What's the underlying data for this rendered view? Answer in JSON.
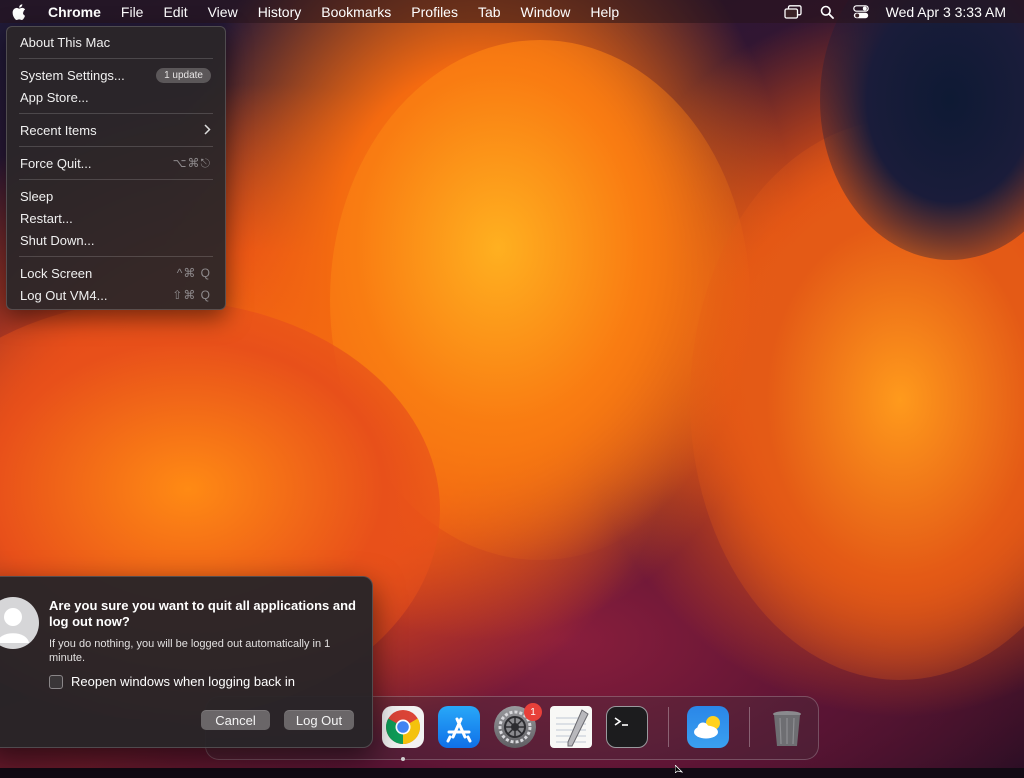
{
  "menubar": {
    "app_name": "Chrome",
    "items": [
      "File",
      "Edit",
      "View",
      "History",
      "Bookmarks",
      "Profiles",
      "Tab",
      "Window",
      "Help"
    ],
    "clock": "Wed Apr 3  3:33 AM",
    "icons": [
      "apple-icon",
      "window-stack-icon",
      "search-icon",
      "control-center-icon"
    ]
  },
  "apple_menu": {
    "about": "About This Mac",
    "system_settings": "System Settings...",
    "update_badge": "1 update",
    "app_store": "App Store...",
    "recent_items": "Recent Items",
    "force_quit": "Force Quit...",
    "force_quit_shortcut": "⌥⌘⎋",
    "sleep": "Sleep",
    "restart": "Restart...",
    "shut_down": "Shut Down...",
    "lock_screen": "Lock Screen",
    "lock_screen_shortcut": "^⌘ Q",
    "log_out": "Log Out VM4...",
    "log_out_shortcut": "⇧⌘ Q"
  },
  "dialog": {
    "title": "Are you sure you want to quit all applications and log out now?",
    "message": "If you do nothing, you will be logged out automatically in 1 minute.",
    "checkbox_label": "Reopen windows when logging back in",
    "checkbox_checked": false,
    "cancel_label": "Cancel",
    "logout_label": "Log Out"
  },
  "dock": {
    "apps": [
      "chrome-icon",
      "app-store-icon",
      "system-settings-icon",
      "textedit-icon",
      "terminal-icon",
      "weather-icon",
      "trash-icon"
    ],
    "settings_badge": "1"
  },
  "colors": {
    "accent_badge": "#e8403a",
    "menu_bg": "#2a2628",
    "wallpaper_orange": "#f46a10"
  }
}
